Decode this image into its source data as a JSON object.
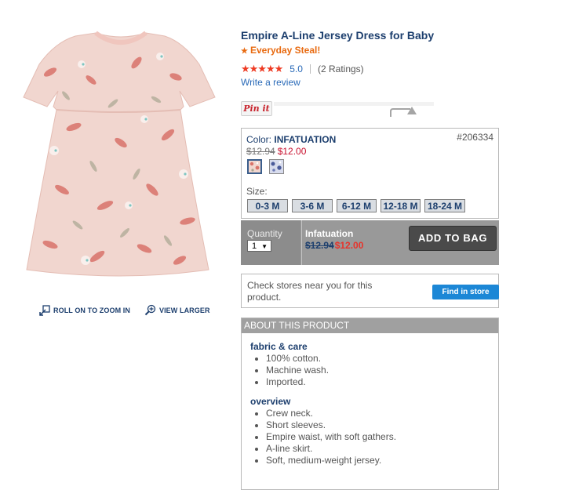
{
  "product": {
    "title": "Empire A-Line Jersey Dress for Baby",
    "badge": "Everyday Steal!",
    "stars": "★★★★★",
    "rating": "5.0",
    "rating_count": "(2 Ratings)",
    "write_review": "Write a review"
  },
  "image_links": {
    "zoom": "ROLL ON TO ZOOM IN",
    "larger": "VIEW LARGER"
  },
  "social": {
    "pin_label": "Pin it"
  },
  "options": {
    "color_prefix": "Color:",
    "color_name": "INFATUATION",
    "sku": "#206334",
    "was_price": "$12.94",
    "now_price": "$12.00",
    "size_label": "Size:",
    "sizes": [
      "0-3 M",
      "3-6 M",
      "6-12 M",
      "12-18 M",
      "18-24 M"
    ]
  },
  "bag": {
    "quantity_label": "Quantity",
    "quantity_value": "1",
    "selected_color": "Infatuation",
    "was_price": "$12.94",
    "now_price": "$12.00",
    "add_label": "ADD TO BAG"
  },
  "store": {
    "text": "Check stores near you for this product.",
    "button": "Find in store"
  },
  "about": {
    "header": "ABOUT THIS PRODUCT",
    "sections": [
      {
        "title": "fabric & care",
        "items": [
          "100% cotton.",
          "Machine wash.",
          "Imported."
        ]
      },
      {
        "title": "overview",
        "items": [
          "Crew neck.",
          "Short sleeves.",
          "Empire waist, with soft gathers.",
          "A-line skirt.",
          "Soft, medium-weight jersey."
        ]
      }
    ]
  },
  "colors": {
    "title_navy": "#1d3f6e",
    "badge_orange": "#e86a10",
    "star_red": "#ee3a22",
    "sale_red": "#c8102e",
    "link_blue": "#2a6ab8",
    "find_button_blue": "#1c87d6",
    "add_button_dark": "#4a4a4a",
    "dress_pink": "#f1d6cf"
  }
}
